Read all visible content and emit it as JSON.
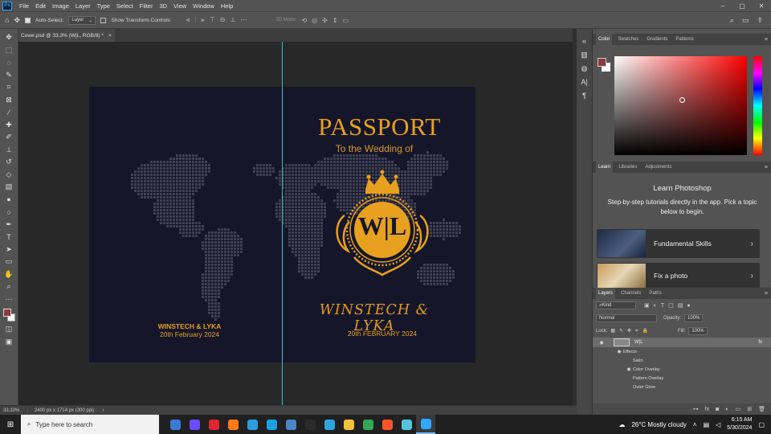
{
  "menubar": {
    "logo": "Ps",
    "items": [
      "File",
      "Edit",
      "Image",
      "Layer",
      "Type",
      "Select",
      "Filter",
      "3D",
      "View",
      "Window",
      "Help"
    ],
    "controls": [
      "–",
      "▢",
      "✕"
    ]
  },
  "options": {
    "auto_select_label": "Auto-Select:",
    "auto_select_target": "Layer",
    "show_transform_label": "Show Transform Controls",
    "mode_3d_label": "3D Mode:"
  },
  "document": {
    "tab_title": "Cover.psd @ 33.3% (W|L, RGB/8) *",
    "close": "×"
  },
  "artwork": {
    "title": "PASSPORT",
    "subtitle": "To the Wedding of",
    "monogram": "W|L",
    "couple_right": "WINSTECH & LYKA",
    "date_right": "20th FEBRUARY 2024",
    "couple_left": "WINSTECH & LYKA",
    "date_left": "20th February 2024",
    "colors": {
      "gold": "#e8a01f",
      "navy": "#15162a",
      "map": "#3f4052"
    }
  },
  "status": {
    "zoom": "33.33%",
    "doc_info": "2400 px x 1714 px (300 ppi)",
    "arrow": "›"
  },
  "color_panel": {
    "tabs": [
      "Color",
      "Swatches",
      "Gradients",
      "Patterns"
    ],
    "foreground": "#8b3a3a",
    "background": "#ffffff"
  },
  "learn_panel": {
    "tabs": [
      "Learn",
      "Libraries",
      "Adjustments"
    ],
    "title": "Learn Photoshop",
    "description": "Step-by-step tutorials directly in the app. Pick a topic below to begin.",
    "cards": [
      "Fundamental Skills",
      "Fix a photo"
    ]
  },
  "layers_panel": {
    "tabs": [
      "Layers",
      "Channels",
      "Paths"
    ],
    "filter": "Kind",
    "blend_mode": "Normal",
    "opacity_label": "Opacity:",
    "opacity_value": "100%",
    "lock_label": "Lock:",
    "fill_label": "Fill:",
    "fill_value": "100%",
    "layer_name": "W|L",
    "fx_badge": "fx",
    "effects_label": "Effects",
    "effects": [
      "Satin",
      "Color Overlay",
      "Pattern Overlay",
      "Outer Glow"
    ]
  },
  "taskbar": {
    "search_placeholder": "Type here to search",
    "weather": "26°C  Mostly cloudy",
    "time": "6:15 AM",
    "date": "5/30/2024",
    "app_colors": [
      "#3a7bd5",
      "#6b4cff",
      "#e0262f",
      "#ff7a18",
      "#2d9cdb",
      "#1ba1e2",
      "#4a86c5",
      "#2b2b2b",
      "#2ea6e0",
      "#f3c23b",
      "#34a853",
      "#fb542b",
      "#52c4e0",
      "#31a8ff"
    ]
  }
}
